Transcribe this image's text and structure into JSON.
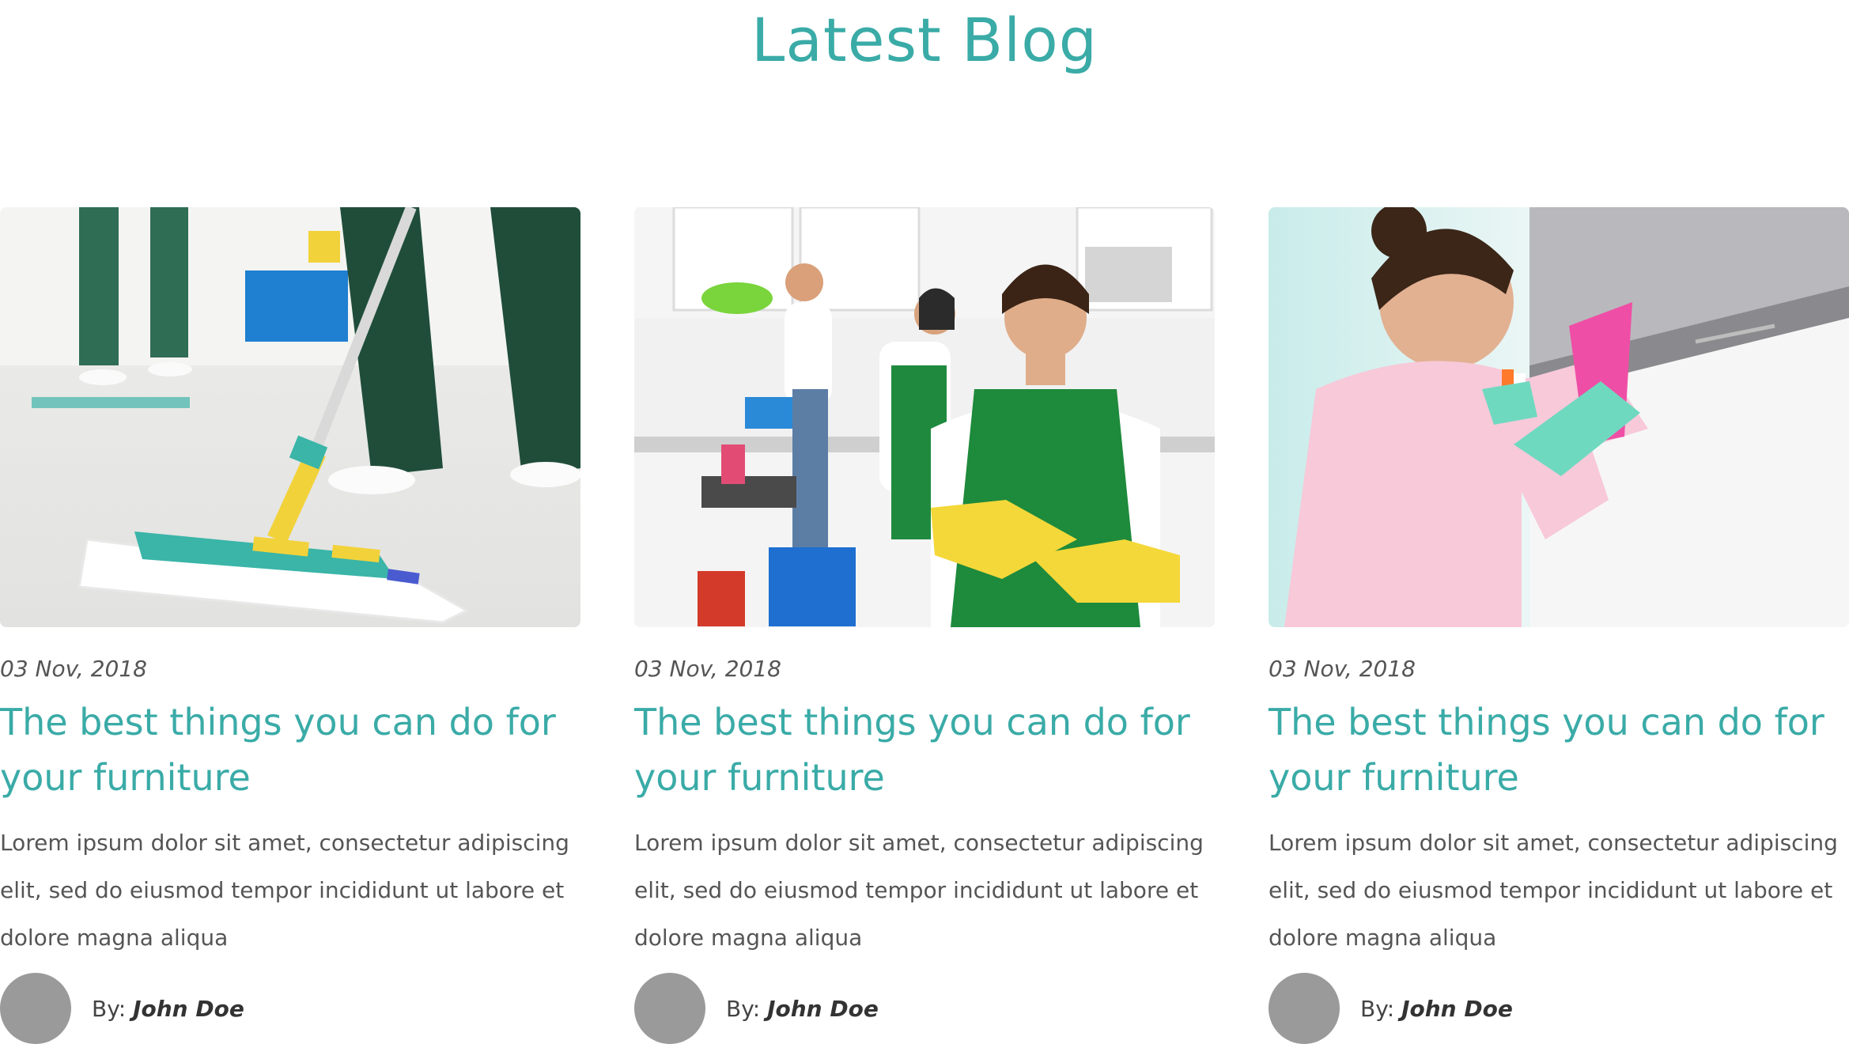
{
  "section": {
    "title": "Latest Blog"
  },
  "posts": [
    {
      "date": "03 Nov, 2018",
      "title_line1": "The best things you can do for",
      "title_line2": "your furniture",
      "excerpt_line1": "Lorem ipsum dolor sit amet, consectetur adipiscing",
      "excerpt_line2": "elit, sed do eiusmod tempor incididunt ut labore et",
      "excerpt_line3": "dolore magna aliqua",
      "by_label": "By:",
      "author": "John Doe",
      "image_icon": "mop-floor-cleaning-photo"
    },
    {
      "date": "03 Nov, 2018",
      "title_line1": "The best things you can do for",
      "title_line2": "your furniture",
      "excerpt_line1": "Lorem ipsum dolor sit amet, consectetur adipiscing",
      "excerpt_line2": "elit, sed do eiusmod tempor incididunt ut labore et",
      "excerpt_line3": "dolore magna aliqua",
      "by_label": "By:",
      "author": "John Doe",
      "image_icon": "cleaning-team-kitchen-photo"
    },
    {
      "date": "03 Nov, 2018",
      "title_line1": "The best things you can do for",
      "title_line2": "your furniture",
      "excerpt_line1": "Lorem ipsum dolor sit amet, consectetur adipiscing",
      "excerpt_line2": "elit, sed do eiusmod tempor incididunt ut labore et",
      "excerpt_line3": "dolore magna aliqua",
      "by_label": "By:",
      "author": "John Doe",
      "image_icon": "woman-wiping-cabinet-photo"
    }
  ],
  "colors": {
    "accent": "#3aaba7",
    "body_text": "#555555",
    "avatar": "#9a9a9a"
  }
}
